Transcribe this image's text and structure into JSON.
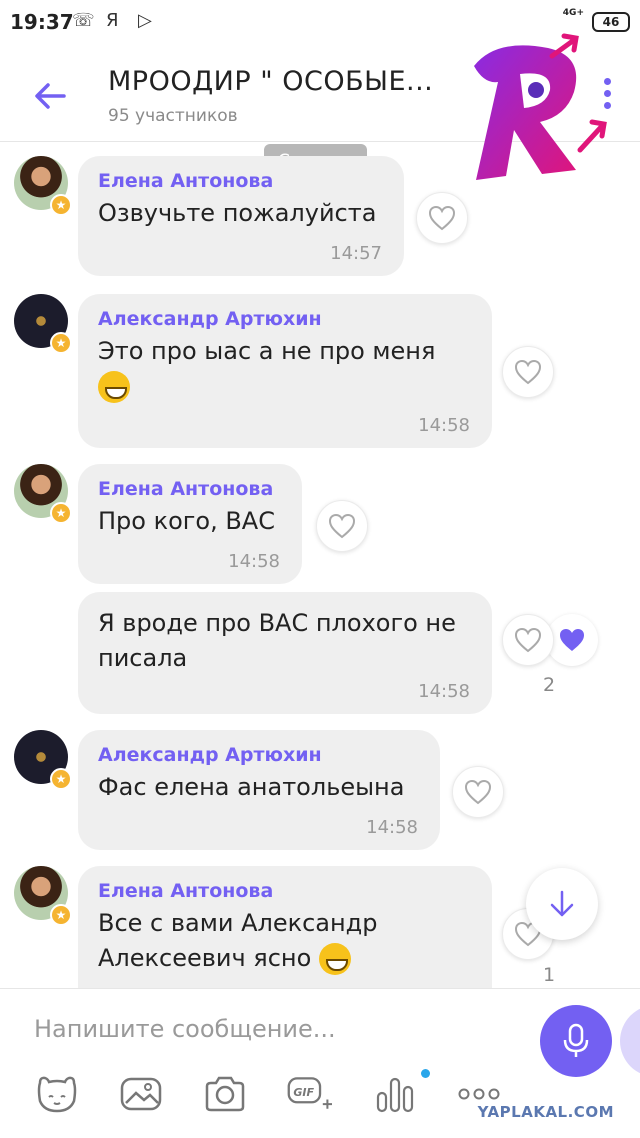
{
  "status_bar": {
    "time": "19:37",
    "network": "4G+",
    "battery": "46"
  },
  "header": {
    "title": "МРООДИР \" ОСОБЫЕ...",
    "subtitle": "95 участников"
  },
  "date_chip": "Сегодня",
  "messages": [
    {
      "sender": "Елена Антонова",
      "text": "Озвучьте пожалуйста",
      "time": "14:57"
    },
    {
      "sender": "Александр Артюхин",
      "text": "Это про ыас а не про меня",
      "time": "14:58"
    },
    {
      "sender": "Елена Антонова",
      "text": "Про кого, ВАС",
      "time": "14:58"
    },
    {
      "sender": "",
      "text": "Я вроде про ВАС плохого не писала",
      "time": "14:58",
      "likes": "2"
    },
    {
      "sender": "Александр Артюхин",
      "text": "Фас елена анатольеына",
      "time": "14:58"
    },
    {
      "sender": "Елена Антонова",
      "text": "Все с вами Александр Алексеевич ясно",
      "likes": "1"
    }
  ],
  "composer": {
    "placeholder": "Напишите сообщение..."
  },
  "icons": [
    "back-arrow-icon",
    "more-vert-icon",
    "heart-icon",
    "scroll-down-icon",
    "sticker-icon",
    "gallery-icon",
    "camera-icon",
    "gif-icon",
    "poll-icon",
    "more-icon",
    "microphone-icon"
  ],
  "colors": {
    "accent": "#7360f2",
    "bubble": "#efefef",
    "timestamp": "#9a9a9a"
  },
  "watermark": "YAPLAKAL.COM"
}
